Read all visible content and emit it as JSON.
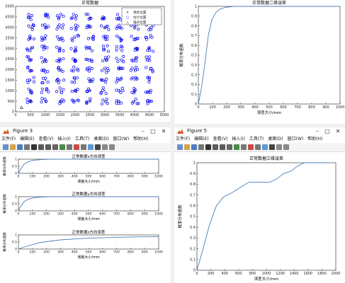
{
  "plot_tl": {
    "title": "正常数据",
    "legend": [
      {
        "label": "目标位置",
        "marker": "x"
      },
      {
        "label": "估计位置",
        "marker": "o"
      },
      {
        "label": "锚点位置",
        "marker": "^"
      }
    ],
    "xticks": [
      "0",
      "500",
      "1000",
      "1500",
      "2000",
      "2500",
      "3000",
      "3500",
      "4000",
      "4500",
      "5000"
    ],
    "yticks": [
      "0",
      "500",
      "1000",
      "1500",
      "2000",
      "2500",
      "3000",
      "3500",
      "4000",
      "4500",
      "5000"
    ]
  },
  "plot_tr": {
    "title": "正常数据二维误差",
    "ylabel": "概率分布函数",
    "xlabel": "误差大小/mm",
    "xticks": [
      "0",
      "100",
      "200",
      "300",
      "400",
      "500",
      "600",
      "700",
      "800",
      "900",
      "1000"
    ],
    "yticks": [
      "0",
      "0.1",
      "0.2",
      "0.3",
      "0.4",
      "0.5",
      "0.6",
      "0.7",
      "0.8",
      "0.9",
      "1"
    ]
  },
  "window3": {
    "title": "Figure 3",
    "menu": [
      "文件(F)",
      "编辑(E)",
      "查看(V)",
      "插入(I)",
      "工具(T)",
      "桌面(D)",
      "窗口(W)",
      "帮助(H)"
    ],
    "toolbar_icons": [
      "new-file",
      "open-file",
      "save",
      "print",
      "pointer",
      "zoom-in",
      "zoom-out",
      "pan",
      "rotate",
      "data-cursor",
      "brush",
      "link",
      "insert-colorbar",
      "insert-legend",
      "hide-plot-tools",
      "show-plot-tools"
    ],
    "subplots": [
      {
        "title": "正常数据x方向误差",
        "ylabel": "概率分布函数"
      },
      {
        "title": "正常数据y方向误差",
        "ylabel": "概率分布函数"
      },
      {
        "title": "正常数据z方向误差",
        "ylabel": "概率分布函数"
      }
    ],
    "xlabel": "误差大小/mm",
    "xticks": [
      "0",
      "100",
      "200",
      "300",
      "400",
      "500",
      "600",
      "700",
      "800",
      "900",
      "1000"
    ],
    "yticks": [
      "0",
      "0.5",
      "1"
    ]
  },
  "window5": {
    "title": "Figure 5",
    "menu": [
      "文件(F)",
      "编辑(E)",
      "查看(V)",
      "插入(I)",
      "工具(T)",
      "桌面(D)",
      "窗口(W)",
      "帮助(H)"
    ],
    "toolbar_icons": [
      "new-file",
      "open-file",
      "save",
      "print",
      "pointer",
      "zoom-in",
      "zoom-out",
      "pan",
      "rotate",
      "data-cursor",
      "brush",
      "link",
      "insert-colorbar",
      "insert-legend",
      "hide-plot-tools",
      "show-plot-tools"
    ],
    "title_plot": "正常数据三维误差",
    "ylabel": "概率分布函数",
    "xlabel": "误差大小/mm",
    "xticks": [
      "0",
      "200",
      "400",
      "600",
      "800",
      "1000",
      "1200",
      "1400",
      "1600",
      "1800",
      "2000"
    ],
    "yticks": [
      "0",
      "0.1",
      "0.2",
      "0.3",
      "0.4",
      "0.5",
      "0.6",
      "0.7",
      "0.8",
      "0.9",
      "1"
    ]
  },
  "colors": {
    "series": "#4b7fb6",
    "marker": "#0000ff"
  }
}
